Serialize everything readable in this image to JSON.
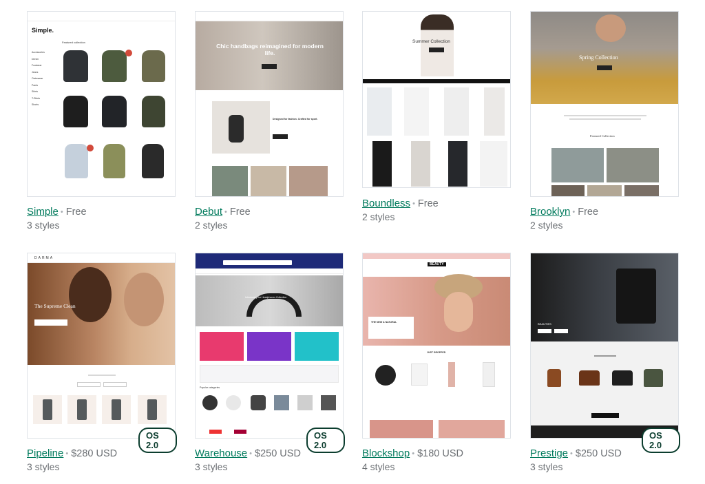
{
  "themes": [
    {
      "name": "Simple",
      "price": "Free",
      "styles": "3 styles",
      "badge": "",
      "preview": {
        "logo": "Simple.",
        "heading": "Featured collection",
        "nav": [
          "Accessories",
          "Denim",
          "Footwear",
          "Jeans",
          "Outerwear",
          "Pants",
          "Shirts",
          "T-Shirts",
          "Shorts"
        ]
      }
    },
    {
      "name": "Debut",
      "price": "Free",
      "styles": "2 styles",
      "badge": "",
      "preview": {
        "hero": "Chic handbags reimagined for modern life.",
        "sub": "Designed for fashion. Crafted for sport."
      }
    },
    {
      "name": "Boundless",
      "price": "Free",
      "styles": "2 styles",
      "badge": "",
      "preview": {
        "hero": "Summer Collection"
      }
    },
    {
      "name": "Brooklyn",
      "price": "Free",
      "styles": "2 styles",
      "badge": "",
      "preview": {
        "hero": "Spring Collection",
        "heading": "Featured Collection"
      }
    },
    {
      "name": "Pipeline",
      "price": "$280 USD",
      "styles": "3 styles",
      "badge": "OS 2.0",
      "preview": {
        "logo": "DARMA",
        "hero": "The Supreme Clean"
      }
    },
    {
      "name": "Warehouse",
      "price": "$250 USD",
      "styles": "3 styles",
      "badge": "OS 2.0",
      "preview": {
        "hero": "Introducing the Headphones Collection",
        "heading": "Popular categories"
      }
    },
    {
      "name": "Blockshop",
      "price": "$180 USD",
      "styles": "4 styles",
      "badge": "",
      "preview": {
        "logo": "BEAUTY",
        "hero": "THE NEW & NATURAL",
        "heading": "JUST DROPPED"
      }
    },
    {
      "name": "Prestige",
      "price": "$250 USD",
      "styles": "3 styles",
      "badge": "OS 2.0",
      "preview": {
        "heading": "BEAUTIES"
      }
    }
  ],
  "separator": "•",
  "colors": {
    "link": "#007a5c",
    "badge_border": "#0b3d2e",
    "text": "#6d7175"
  }
}
